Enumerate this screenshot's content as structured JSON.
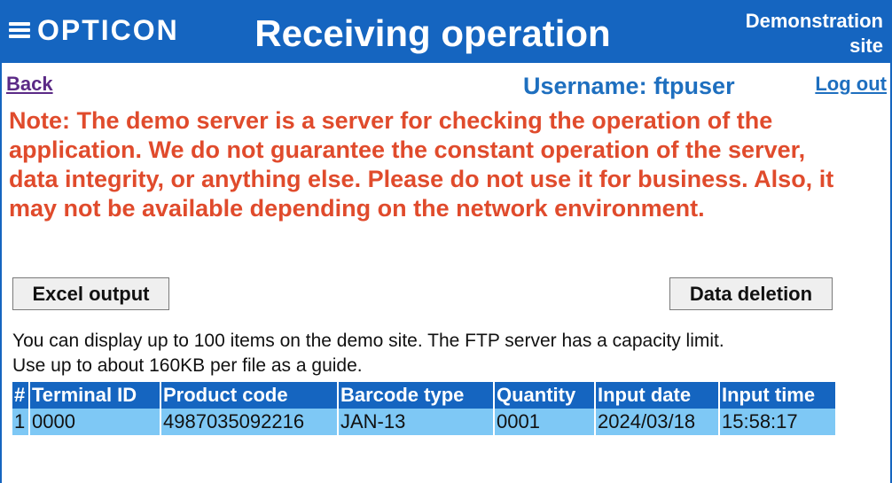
{
  "header": {
    "logo": "OPTICON",
    "title": "Receiving operation",
    "site_line1": "Demonstration",
    "site_line2": "site",
    "colors": {
      "bar": "#1565c0",
      "text": "#ffffff"
    }
  },
  "nav": {
    "back_label": "Back",
    "username": "Username: ftpuser",
    "logout_label": "Log out"
  },
  "note": "Note: The demo server is a server for checking the operation of the application. We do not guarantee the constant operation of the server, data integrity, or anything else. Please do not use it for business. Also, it may not be available depending on the network environment.",
  "buttons": {
    "excel_label": "Excel output",
    "delete_label": "Data deletion"
  },
  "info": {
    "line1": "You can display up to 100 items on the demo site. The FTP server has a capacity limit.",
    "line2": "Use up to about 160KB per file as a guide."
  },
  "table": {
    "headers": [
      "#",
      "Terminal ID",
      "Product code",
      "Barcode type",
      "Quantity",
      "Input date",
      "Input time"
    ],
    "rows": [
      [
        "1",
        "0000",
        "4987035092216",
        "JAN-13",
        "0001",
        "2024/03/18",
        "15:58:17"
      ]
    ],
    "colors": {
      "header": "#1565c0",
      "row": "#7ec8f5"
    }
  },
  "icons": {
    "menu": "hamburger-menu-icon"
  }
}
